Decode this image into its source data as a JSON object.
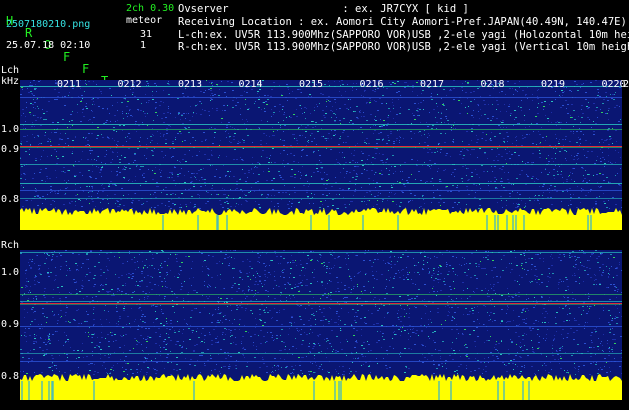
{
  "app": {
    "title_letters": [
      "H",
      "R",
      "O",
      "F",
      "F",
      "T"
    ],
    "mode": "2ch 0.30",
    "filename": "2507180210.png",
    "timestamp": "25.07.18 02:10",
    "meteor_label": "meteor",
    "count_l": "31",
    "count_r": "1"
  },
  "info": {
    "observer": "Ovserver                  : ex. JR7CYX [ kid ]",
    "location": "Receiving Location : ex. Aomori City Aomori-Pref.JAPAN(40.49N, 140.47E)",
    "lch": "L-ch:ex. UV5R 113.900Mhz(SAPPORO VOR)USB ,2-ele yagi (Holozontal 10m height)",
    "rch": "R-ch:ex. UV5R 113.900Mhz(SAPPORO VOR)USB ,2-ele yagi (Vertical 10m height)"
  },
  "lch_panel": {
    "channel_label": "Lch",
    "unit_label": "kHz",
    "yticks": [
      "1.0",
      "0.9",
      "0.8"
    ],
    "time_labels": [
      "0211",
      "0212",
      "0213",
      "0214",
      "0215",
      "0216",
      "0217",
      "0218",
      "0219",
      "0220"
    ],
    "right_edge_label": "2"
  },
  "rch_panel": {
    "channel_label": "Rch",
    "yticks": [
      "1.0",
      "0.9",
      "0.8"
    ]
  },
  "colors": {
    "background": "#000000",
    "waterfall": "#0a1673",
    "noise": [
      "#1d2fa8",
      "#2a4fd0",
      "#1e8fb0",
      "#28c0c0",
      "#30d060"
    ],
    "signal_line": "#ff3030",
    "amplitude": "#ffff00",
    "title": "#22ee22",
    "meta": "#36e3e3"
  }
}
